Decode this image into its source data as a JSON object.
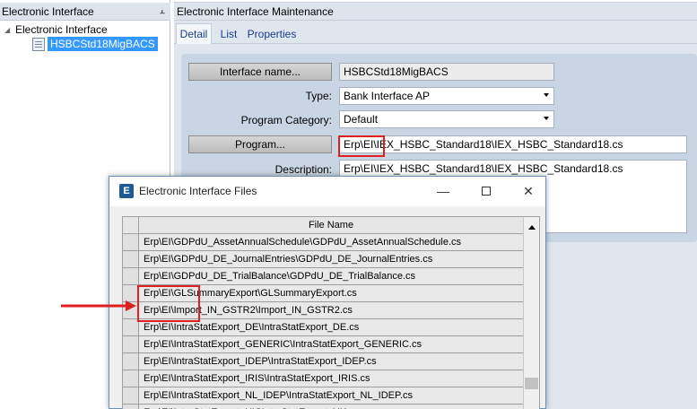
{
  "left_panel": {
    "title": "Electronic Interface",
    "pin_glyph": "⫠",
    "tree": {
      "root_label": "Electronic Interface",
      "expander_glyph": "◢",
      "child_label": "HSBCStd18MigBACS"
    }
  },
  "main_panel": {
    "title": "Electronic Interface Maintenance",
    "tabs": [
      "Detail",
      "List",
      "Properties"
    ],
    "active_tab": "Detail",
    "form": {
      "interface_name_button": "Interface name...",
      "interface_name_value": "HSBCStd18MigBACS",
      "type_label": "Type:",
      "type_value": "Bank Interface AP",
      "program_category_label": "Program Category:",
      "program_category_value": "Default",
      "program_button": "Program...",
      "program_value": "Erp\\EI\\IEX_HSBC_Standard18\\IEX_HSBC_Standard18.cs",
      "description_label": "Description:",
      "description_value": "Erp\\EI\\IEX_HSBC_Standard18\\IEX_HSBC_Standard18.cs"
    }
  },
  "dialog": {
    "title": "Electronic Interface Files",
    "icon_letter": "E",
    "minimize_glyph": "—",
    "close_glyph": "✕",
    "column_header": "File Name",
    "rows": [
      "Erp\\EI\\GDPdU_AssetAnnualSchedule\\GDPdU_AssetAnnualSchedule.cs",
      "Erp\\EI\\GDPdU_DE_JournalEntries\\GDPdU_DE_JournalEntries.cs",
      "Erp\\EI\\GDPdU_DE_TrialBalance\\GDPdU_DE_TrialBalance.cs",
      "Erp\\EI\\GLSummaryExport\\GLSummaryExport.cs",
      "Erp\\EI\\Import_IN_GSTR2\\Import_IN_GSTR2.cs",
      "Erp\\EI\\IntraStatExport_DE\\IntraStatExport_DE.cs",
      "Erp\\EI\\IntraStatExport_GENERIC\\IntraStatExport_GENERIC.cs",
      "Erp\\EI\\IntraStatExport_IDEP\\IntraStatExport_IDEP.cs",
      "Erp\\EI\\IntraStatExport_IRIS\\IntraStatExport_IRIS.cs",
      "Erp\\EI\\IntraStatExport_NL_IDEP\\IntraStatExport_NL_IDEP.cs",
      "Erp\\EI\\IntraStatExport_UK\\IntraStatExport_UK.cs"
    ]
  },
  "colors": {
    "selection": "#3399ff",
    "annotation": "#e02020"
  }
}
